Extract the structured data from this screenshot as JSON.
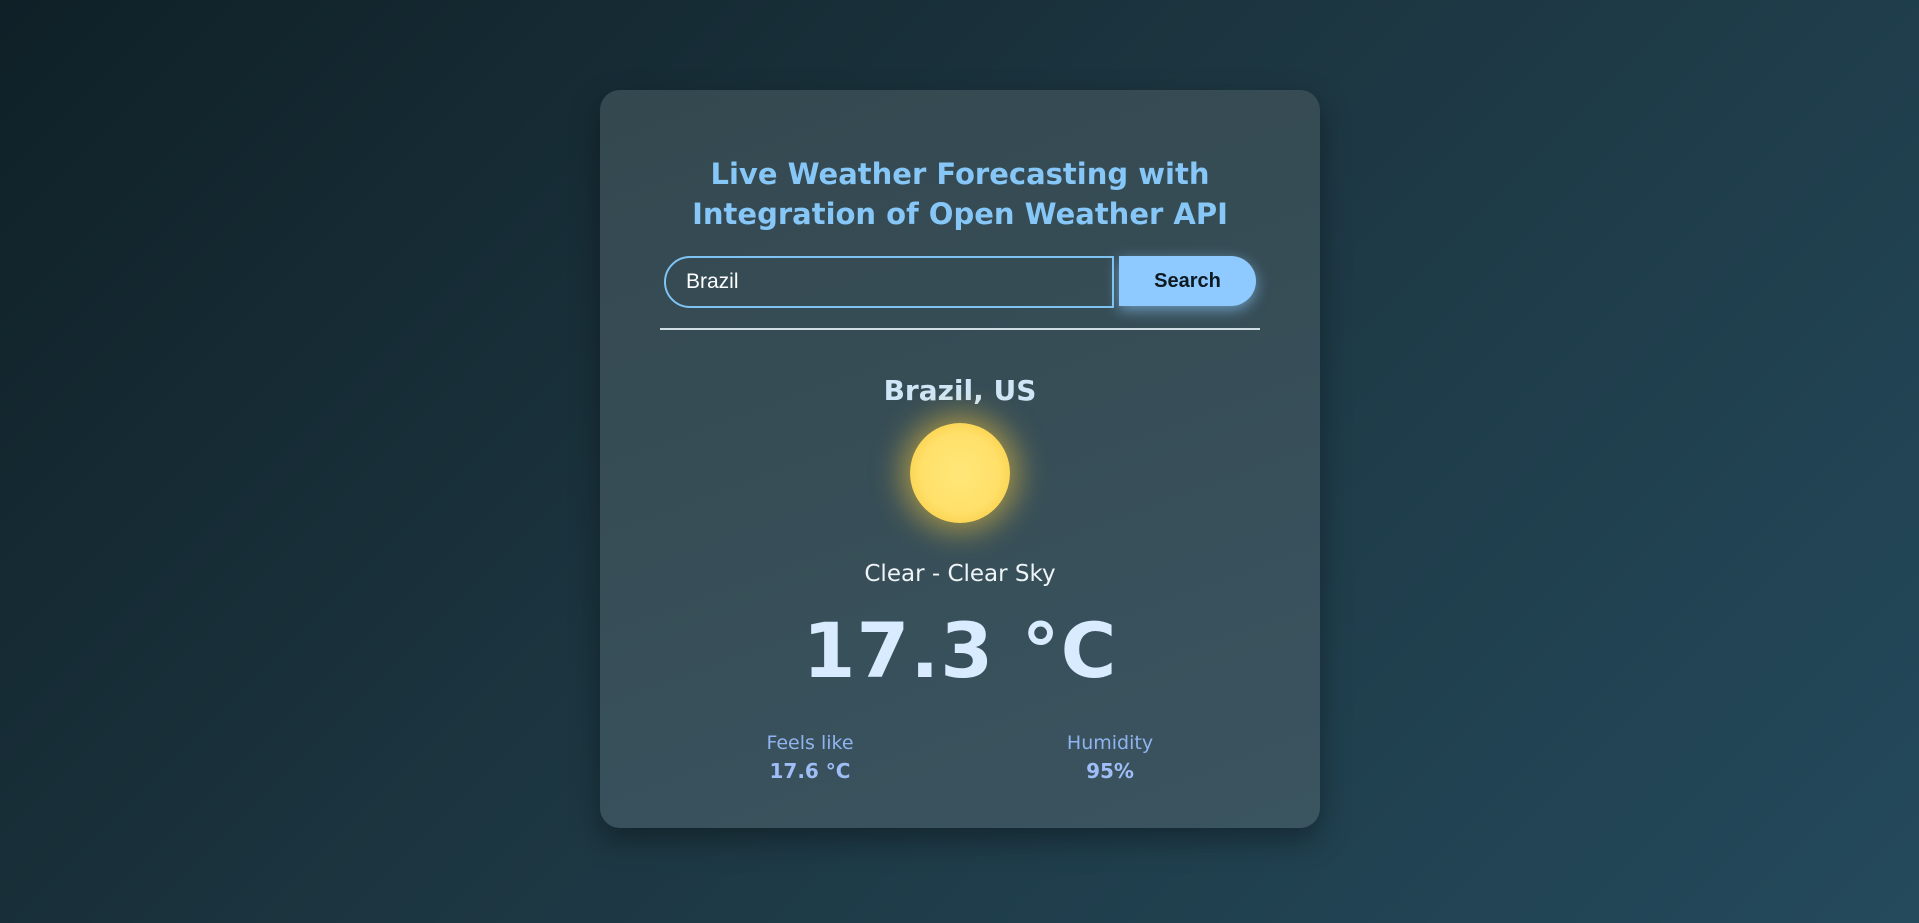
{
  "app": {
    "title": "Live Weather Forecasting with Integration of Open Weather API"
  },
  "search": {
    "value": "Brazil",
    "button_label": "Search"
  },
  "weather": {
    "location": "Brazil, US",
    "icon": "sun-icon",
    "description": "Clear - Clear Sky",
    "temperature": "17.3 °C",
    "feels_like_label": "Feels like",
    "feels_like_value": "17.6 °C",
    "humidity_label": "Humidity",
    "humidity_value": "95%"
  },
  "colors": {
    "accent": "#8ecaff",
    "title": "#86c7f7",
    "sun": "#ffe06a"
  }
}
